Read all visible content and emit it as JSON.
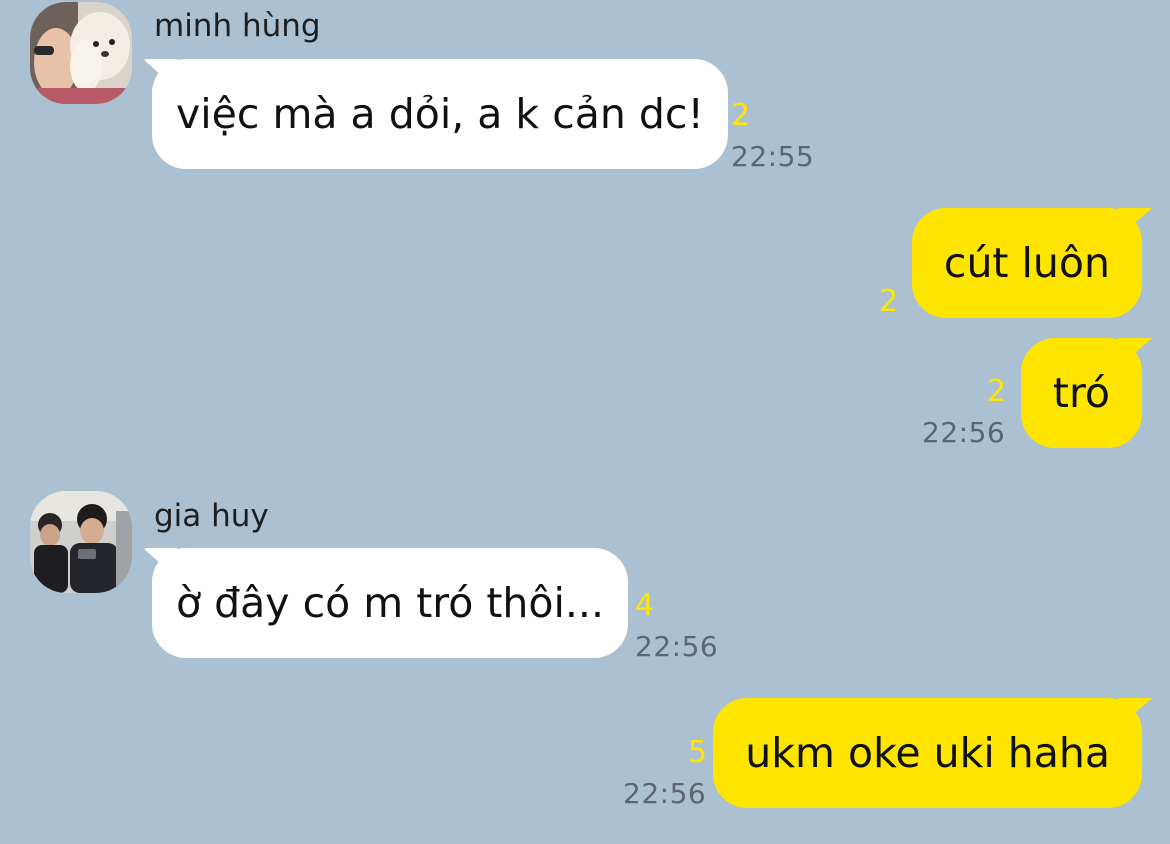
{
  "colors": {
    "background": "#abc1d2",
    "incoming_bubble": "#ffffff",
    "outgoing_bubble": "#fee500",
    "unread_count": "#ffe600",
    "timestamp": "#5c6670"
  },
  "messages": [
    {
      "direction": "incoming",
      "sender": "minh hùng",
      "avatar_icon": "profile-photo-person-with-dog",
      "text": "việc mà a dỏi, a k cản dc!",
      "unread": "2",
      "time": "22:55"
    },
    {
      "direction": "outgoing",
      "text": "cút luôn",
      "unread": "2",
      "time": ""
    },
    {
      "direction": "outgoing",
      "text": "tró",
      "unread": "2",
      "time": "22:56"
    },
    {
      "direction": "incoming",
      "sender": "gia huy",
      "avatar_icon": "profile-photo-group-of-friends",
      "text": "ờ đây có m tró thôi...",
      "unread": "4",
      "time": "22:56"
    },
    {
      "direction": "outgoing",
      "text": "ukm oke uki haha",
      "unread": "5",
      "time": "22:56"
    }
  ]
}
